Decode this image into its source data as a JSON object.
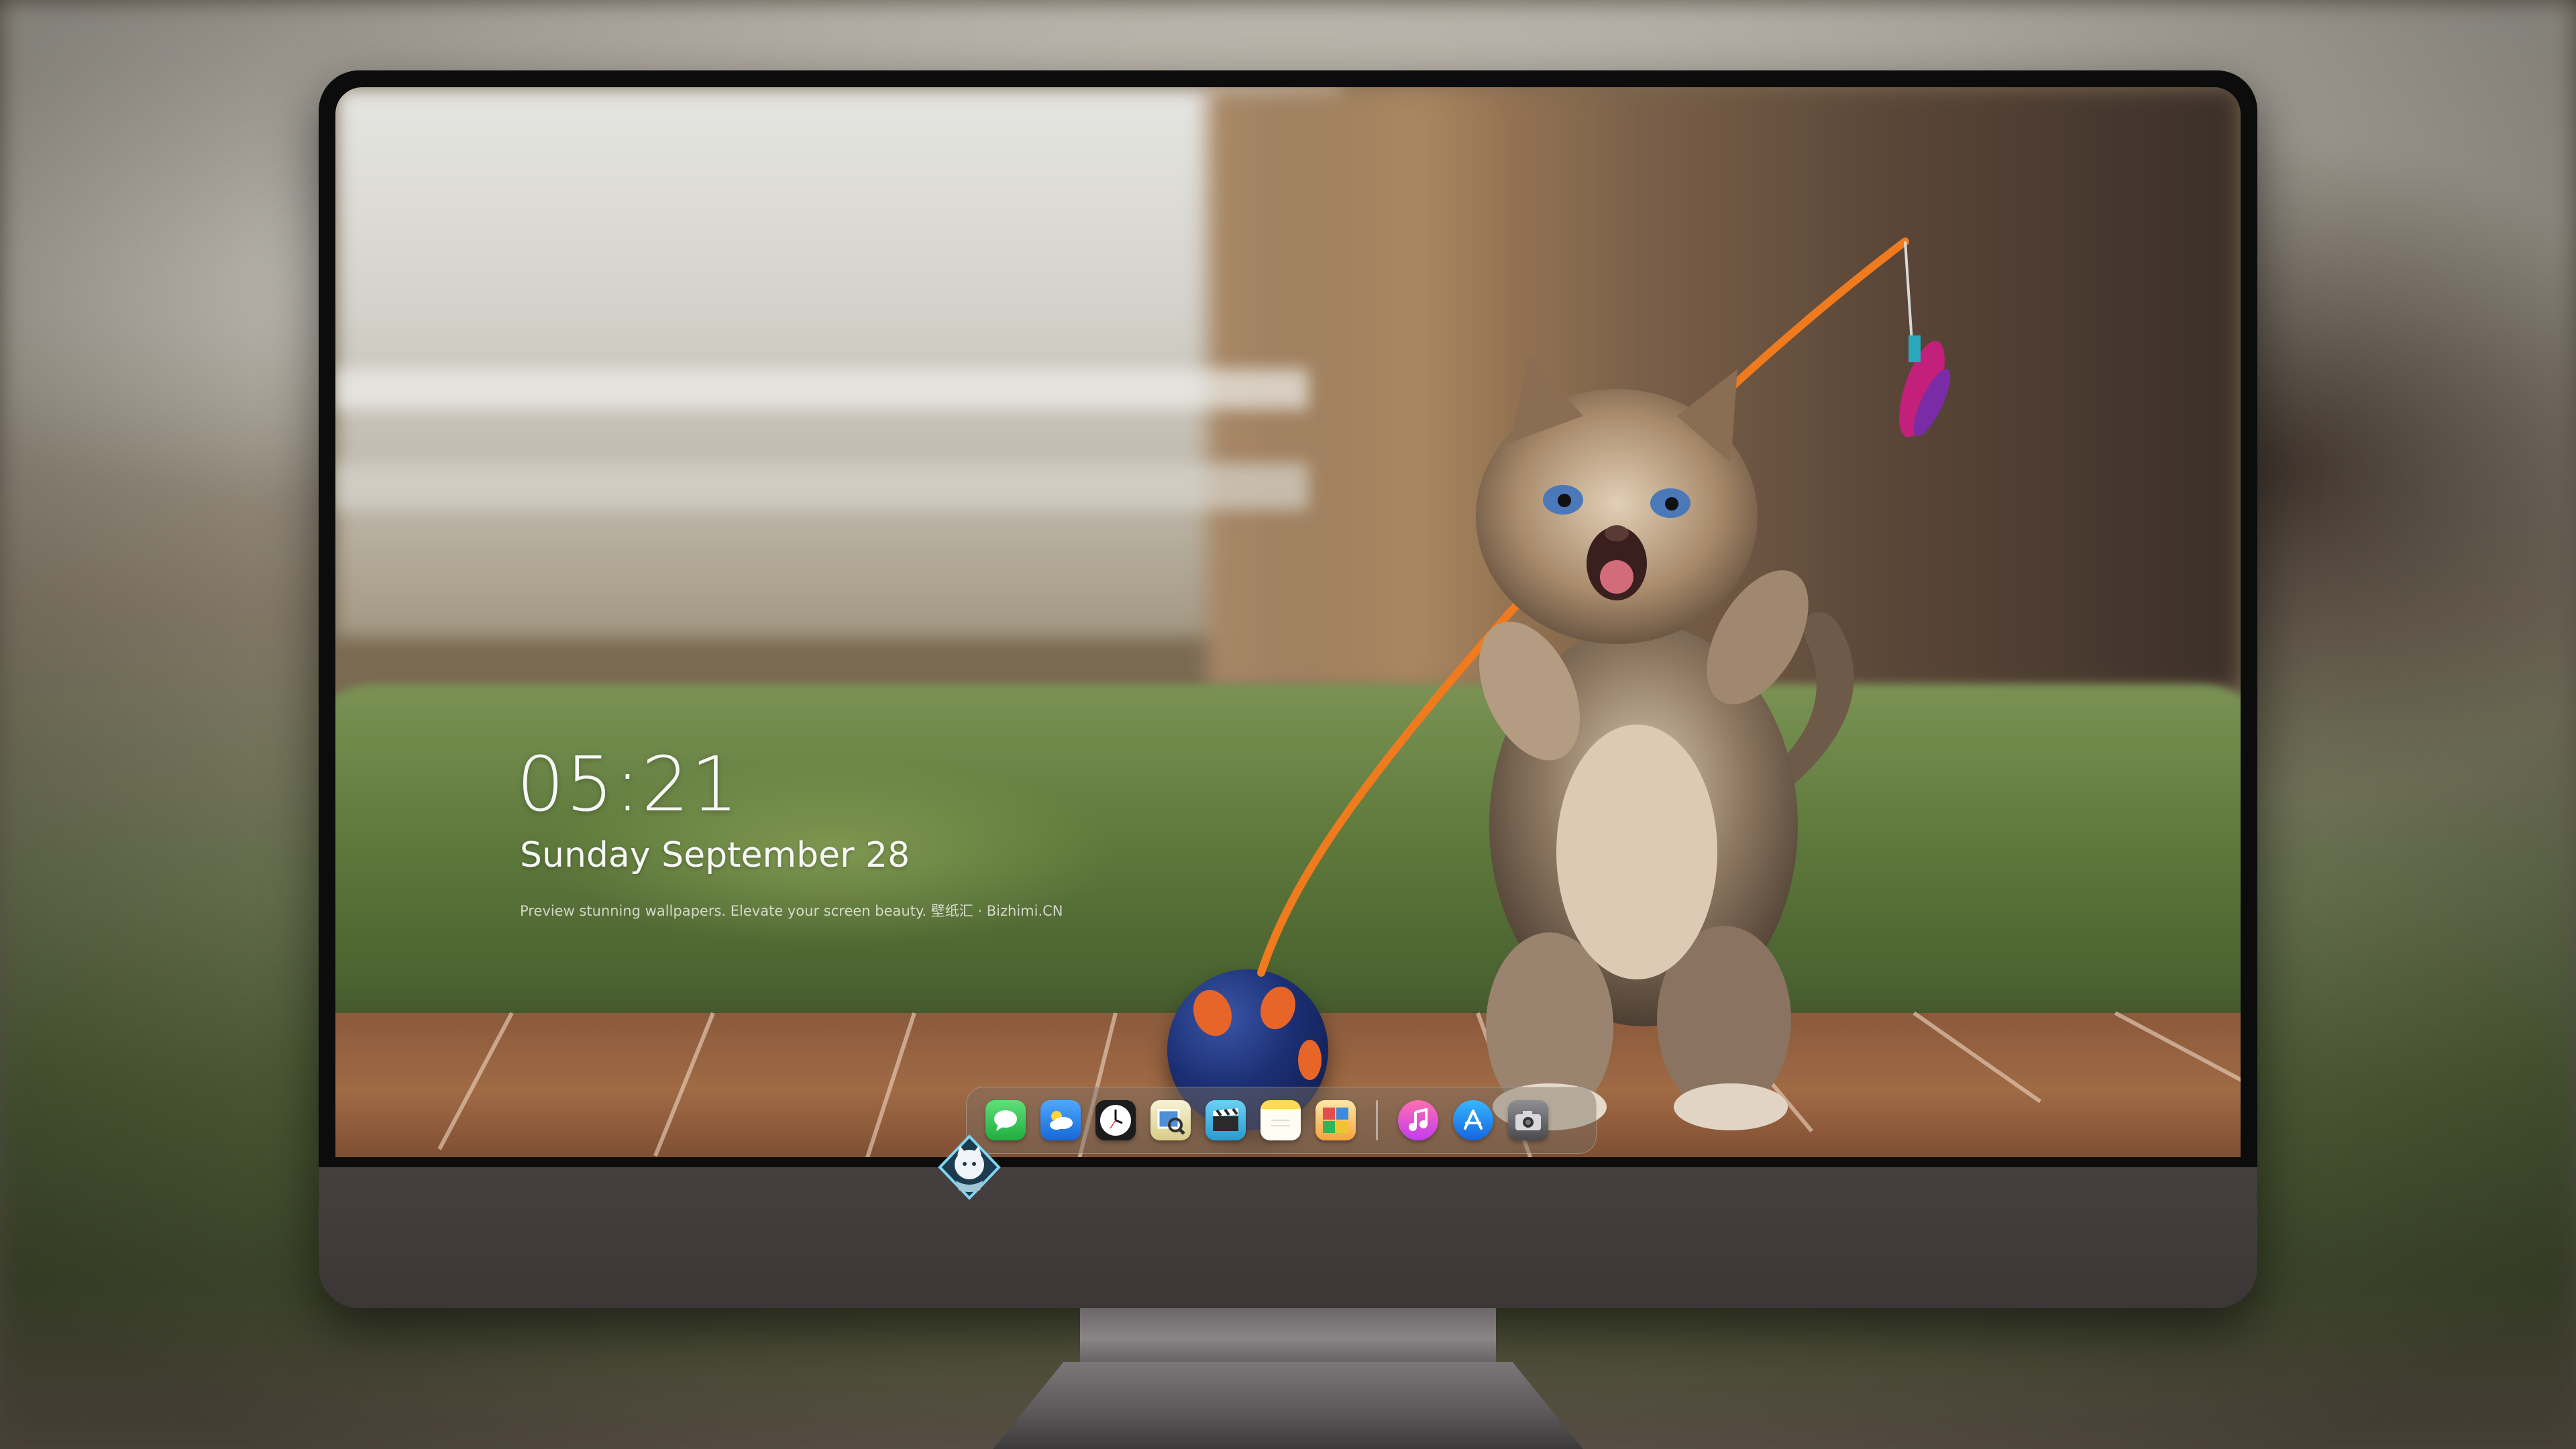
{
  "lockscreen": {
    "time": "05:21",
    "date": "Sunday September  28",
    "caption": "Preview stunning wallpapers. Elevate your screen beauty. 壁纸汇 · Bizhimi.CN"
  },
  "dock": {
    "items": [
      {
        "name": "messages-icon",
        "color": "#34c759"
      },
      {
        "name": "weather-icon",
        "color": "#2f8cf0"
      },
      {
        "name": "clock-icon",
        "color": "#ffffff"
      },
      {
        "name": "preview-icon",
        "color": "#e9c446"
      },
      {
        "name": "clips-icon",
        "color": "#3aaee0"
      },
      {
        "name": "notes-icon",
        "color": "#f7d36b"
      },
      {
        "name": "photos-icon",
        "color": "#f0a030"
      },
      {
        "name": "music-icon",
        "color": "#fa3c8c"
      },
      {
        "name": "app-store-icon",
        "color": "#1e88f5"
      },
      {
        "name": "camera-icon",
        "color": "#5f5f61"
      }
    ]
  },
  "monitor": {
    "logo": "cat-astronaut-logo-icon"
  }
}
